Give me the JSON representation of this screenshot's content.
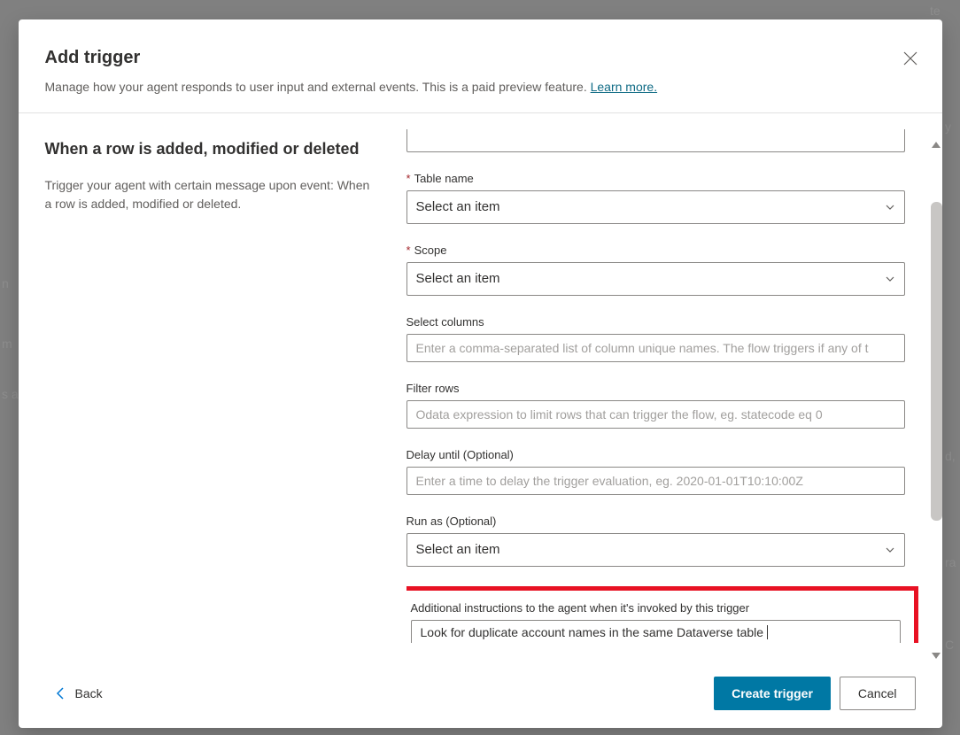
{
  "header": {
    "title": "Add trigger",
    "subtitle": "Manage how your agent responds to user input and external events. This is a paid preview feature. ",
    "learn_more": "Learn more."
  },
  "left": {
    "title": "When a row is added, modified or deleted",
    "description": "Trigger your agent with certain message upon event: When a row is added, modified or deleted."
  },
  "form": {
    "table_name": {
      "label": "Table name",
      "placeholder": "Select an item"
    },
    "scope": {
      "label": "Scope",
      "placeholder": "Select an item"
    },
    "select_columns": {
      "label": "Select columns",
      "placeholder": "Enter a comma-separated list of column unique names. The flow triggers if any of t"
    },
    "filter_rows": {
      "label": "Filter rows",
      "placeholder": "Odata expression to limit rows that can trigger the flow, eg. statecode eq 0"
    },
    "delay_until": {
      "label": "Delay until (Optional)",
      "placeholder": "Enter a time to delay the trigger evaluation, eg. 2020-01-01T10:10:00Z"
    },
    "run_as": {
      "label": "Run as (Optional)",
      "placeholder": "Select an item"
    },
    "additional": {
      "label": "Additional instructions to the agent when it's invoked by this trigger",
      "value": "Look for duplicate account names in the same Dataverse table"
    }
  },
  "footer": {
    "back": "Back",
    "create": "Create trigger",
    "cancel": "Cancel"
  },
  "required_mark": "*"
}
